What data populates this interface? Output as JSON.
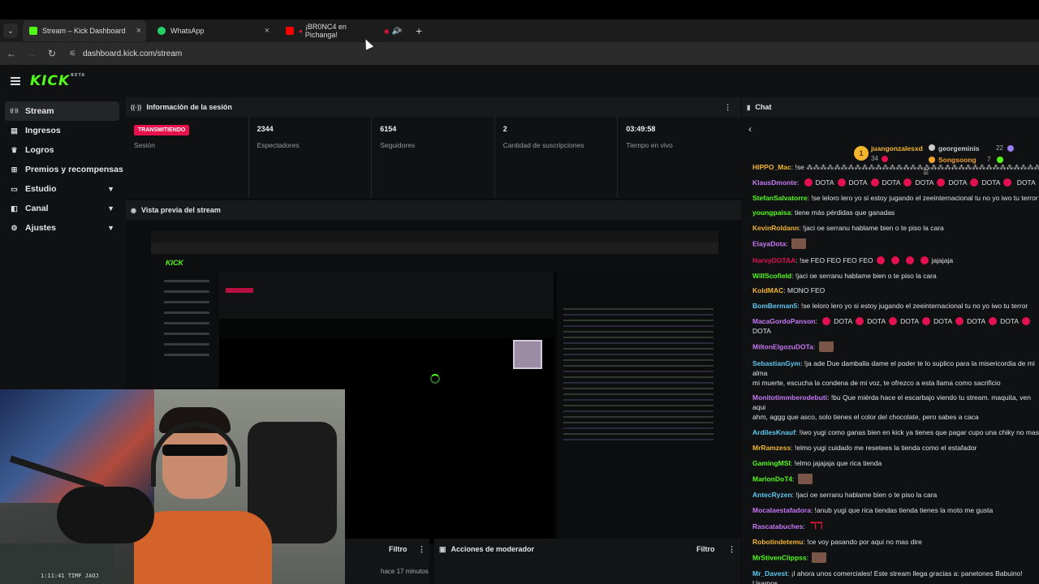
{
  "browser": {
    "tabs": [
      {
        "title": "Stream – Kick Dashboard",
        "favicon_color": "#53fc18"
      },
      {
        "title": "WhatsApp",
        "favicon_color": "#25d366"
      },
      {
        "title": "¡BR0NC4 en Pichanga!",
        "favicon_color": "#ff0000"
      }
    ],
    "url": "dashboard.kick.com/stream",
    "new_tab": "+",
    "close": "×"
  },
  "app": {
    "logo": "KICK",
    "logo_badge": "BETA"
  },
  "sidebar": {
    "items": [
      {
        "label": "Stream",
        "icon": "broadcast-icon",
        "glyph": "((·))"
      },
      {
        "label": "Ingresos",
        "icon": "receipt-icon",
        "glyph": "▤"
      },
      {
        "label": "Logros",
        "icon": "trophy-icon",
        "glyph": "♛"
      },
      {
        "label": "Premios y recompensas",
        "icon": "gift-icon",
        "glyph": "⊞"
      },
      {
        "label": "Estudio",
        "icon": "monitor-icon",
        "glyph": "▭"
      },
      {
        "label": "Canal",
        "icon": "rss-icon",
        "glyph": "◧"
      },
      {
        "label": "Ajustes",
        "icon": "gear-icon",
        "glyph": "⚙"
      }
    ]
  },
  "session": {
    "title": "Información de la sesión",
    "status": "TRANSMITIENDO",
    "status_label": "Sesión",
    "viewers": "2344",
    "viewers_label": "Espectadores",
    "followers": "6154",
    "followers_label": "Seguidores",
    "subs": "2",
    "subs_label": "Cantidad de suscripciones",
    "uptime": "03:49:58",
    "uptime_label": "Tiempo en vivo"
  },
  "preview": {
    "title": "Vista previa del stream"
  },
  "mod": {
    "filter_left": "Filtro",
    "title": "Acciones de moderador",
    "filter_right": "Filtro",
    "time": "hace 17 minutos"
  },
  "webcam": {
    "overlay_text": "1:11:41  TIMF JAOJ"
  },
  "chat": {
    "title": "Chat",
    "top_gifters": [
      {
        "name": "juangonzalesxd",
        "count": "34",
        "rank": "1",
        "color": "#f3b52d"
      },
      {
        "name": "georgeminis",
        "count": "22",
        "color": "#cccccc"
      },
      {
        "name": "Songsoong",
        "count": "7",
        "color": "#f3a22d"
      }
    ],
    "messages": [
      {
        "user": "HIPPO_Mac",
        "color": "#f3b52d",
        "text": "!se ⁂⁂⁂⁂⁂⁂⁂⁂⁂⁂⁂⁂⁂⁂⁂⁂⁂⁂⁂⁂⁂⁂⁂⁂⁂⁂⁂⁂⁂⁂⁂⁂⁂⁂⁂"
      },
      {
        "user": "KlausDmonte",
        "color": "#c678f5",
        "text": "DOTA",
        "repeat": 6,
        "after": "DOTA"
      },
      {
        "user": "StefanSalvatorre",
        "color": "#53fc18",
        "text": "!se leloro lero yo si estoy jugando el zeeinternacional tu no yo iwo tu terror"
      },
      {
        "user": "youngpaisa",
        "color": "#53fc18",
        "text": "tiene más pérdidas que ganadas"
      },
      {
        "user": "KevinRoldann",
        "color": "#f3b52d",
        "text": "!jaci oe serranu hablame bien o te piso la cara"
      },
      {
        "user": "ElayaDota",
        "color": "#c678f5",
        "text": ""
      },
      {
        "user": "HarvyDOTAA",
        "color": "#e2114f",
        "text": "!se FEO FEO FEO FEO",
        "after": "jajajaja"
      },
      {
        "user": "WillScofield",
        "color": "#53fc18",
        "text": "!jaci oe serranu hablame bien o te piso la cara"
      },
      {
        "user": "KoldMAC",
        "color": "#f3b52d",
        "text": "MONO FEO"
      },
      {
        "user": "BomBerman5",
        "color": "#5ec8f2",
        "text": "!se leloro lero yo si estoy jugando el zeeinternacional tu no yo iwo tu terror"
      },
      {
        "user": "MacaGordoPanson",
        "color": "#c678f5",
        "text": "DOTA",
        "repeat": 6,
        "after": "DOTA"
      },
      {
        "user": "MiltonElgozuDOTa",
        "color": "#c678f5",
        "text": ""
      },
      {
        "user": "SebastianGym",
        "color": "#5ec8f2",
        "text": "!ja ade Due damballa dame el poder te lo suplico para la misericordia de mi alma",
        "line2": "mi muerte, escucha la condena de mi voz, te ofrezco a esta llama como sacrificio"
      },
      {
        "user": "Monitotimmberodebuti",
        "color": "#c678f5",
        "text": "!bu Que miérda hace el escarbajo viendo tu stream. maquita, ven aqui",
        "line2": "ahm, aggg que asco, solo tienes el color del chocolate, pero sabes a caca"
      },
      {
        "user": "ArdilesKnauf",
        "color": "#5ec8f2",
        "text": "!iwo yugi como ganas bien en kick ya tienes que pagar cupo una chiky no mas"
      },
      {
        "user": "MrRamzess",
        "color": "#f3b52d",
        "text": "!elmo yugi cuidado me resetees la tienda como el estafador"
      },
      {
        "user": "GamingMSI",
        "color": "#53fc18",
        "text": "!elmo jajajaja que rica tienda"
      },
      {
        "user": "MarlonDoT4",
        "color": "#53fc18",
        "text": ""
      },
      {
        "user": "AntecRyzen",
        "color": "#5ec8f2",
        "text": "!jaci oe serranu hablame bien o te piso la cara"
      },
      {
        "user": "Mocalaestafadora",
        "color": "#c678f5",
        "text": "!anub yugi que rica tiendas tienda tienes la moto me gusta"
      },
      {
        "user": "Rascatabuches",
        "color": "#c678f5",
        "text": ""
      },
      {
        "user": "Robotindetemu",
        "color": "#f3b52d",
        "text": "!ce voy pasando por aqui no mas dire"
      },
      {
        "user": "MrStivenClippss",
        "color": "#53fc18",
        "text": ""
      },
      {
        "user": "Mr_Davest",
        "color": "#5ec8f2",
        "text": "¡l ahora unos comerciales! Este stream llega gracias a: panetones Babuino! Usamos",
        "line2": "maserada del mercado! compra, Babuino, il vero panetone Huarazino! Cuanta Babu! Cuanta Fru"
      }
    ]
  }
}
